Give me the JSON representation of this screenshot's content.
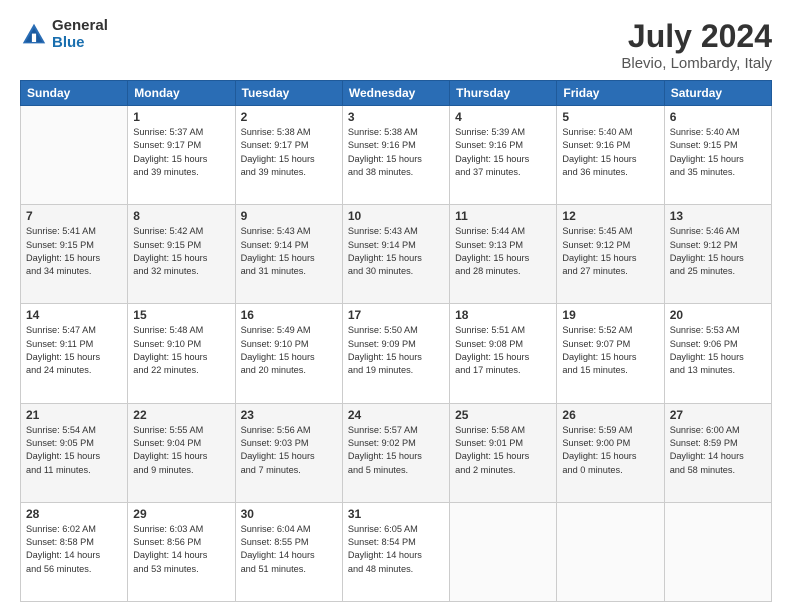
{
  "header": {
    "logo_general": "General",
    "logo_blue": "Blue",
    "title": "July 2024",
    "location": "Blevio, Lombardy, Italy"
  },
  "calendar": {
    "days_of_week": [
      "Sunday",
      "Monday",
      "Tuesday",
      "Wednesday",
      "Thursday",
      "Friday",
      "Saturday"
    ],
    "weeks": [
      [
        {
          "day": "",
          "info": ""
        },
        {
          "day": "1",
          "info": "Sunrise: 5:37 AM\nSunset: 9:17 PM\nDaylight: 15 hours\nand 39 minutes."
        },
        {
          "day": "2",
          "info": "Sunrise: 5:38 AM\nSunset: 9:17 PM\nDaylight: 15 hours\nand 39 minutes."
        },
        {
          "day": "3",
          "info": "Sunrise: 5:38 AM\nSunset: 9:16 PM\nDaylight: 15 hours\nand 38 minutes."
        },
        {
          "day": "4",
          "info": "Sunrise: 5:39 AM\nSunset: 9:16 PM\nDaylight: 15 hours\nand 37 minutes."
        },
        {
          "day": "5",
          "info": "Sunrise: 5:40 AM\nSunset: 9:16 PM\nDaylight: 15 hours\nand 36 minutes."
        },
        {
          "day": "6",
          "info": "Sunrise: 5:40 AM\nSunset: 9:15 PM\nDaylight: 15 hours\nand 35 minutes."
        }
      ],
      [
        {
          "day": "7",
          "info": "Sunrise: 5:41 AM\nSunset: 9:15 PM\nDaylight: 15 hours\nand 34 minutes."
        },
        {
          "day": "8",
          "info": "Sunrise: 5:42 AM\nSunset: 9:15 PM\nDaylight: 15 hours\nand 32 minutes."
        },
        {
          "day": "9",
          "info": "Sunrise: 5:43 AM\nSunset: 9:14 PM\nDaylight: 15 hours\nand 31 minutes."
        },
        {
          "day": "10",
          "info": "Sunrise: 5:43 AM\nSunset: 9:14 PM\nDaylight: 15 hours\nand 30 minutes."
        },
        {
          "day": "11",
          "info": "Sunrise: 5:44 AM\nSunset: 9:13 PM\nDaylight: 15 hours\nand 28 minutes."
        },
        {
          "day": "12",
          "info": "Sunrise: 5:45 AM\nSunset: 9:12 PM\nDaylight: 15 hours\nand 27 minutes."
        },
        {
          "day": "13",
          "info": "Sunrise: 5:46 AM\nSunset: 9:12 PM\nDaylight: 15 hours\nand 25 minutes."
        }
      ],
      [
        {
          "day": "14",
          "info": "Sunrise: 5:47 AM\nSunset: 9:11 PM\nDaylight: 15 hours\nand 24 minutes."
        },
        {
          "day": "15",
          "info": "Sunrise: 5:48 AM\nSunset: 9:10 PM\nDaylight: 15 hours\nand 22 minutes."
        },
        {
          "day": "16",
          "info": "Sunrise: 5:49 AM\nSunset: 9:10 PM\nDaylight: 15 hours\nand 20 minutes."
        },
        {
          "day": "17",
          "info": "Sunrise: 5:50 AM\nSunset: 9:09 PM\nDaylight: 15 hours\nand 19 minutes."
        },
        {
          "day": "18",
          "info": "Sunrise: 5:51 AM\nSunset: 9:08 PM\nDaylight: 15 hours\nand 17 minutes."
        },
        {
          "day": "19",
          "info": "Sunrise: 5:52 AM\nSunset: 9:07 PM\nDaylight: 15 hours\nand 15 minutes."
        },
        {
          "day": "20",
          "info": "Sunrise: 5:53 AM\nSunset: 9:06 PM\nDaylight: 15 hours\nand 13 minutes."
        }
      ],
      [
        {
          "day": "21",
          "info": "Sunrise: 5:54 AM\nSunset: 9:05 PM\nDaylight: 15 hours\nand 11 minutes."
        },
        {
          "day": "22",
          "info": "Sunrise: 5:55 AM\nSunset: 9:04 PM\nDaylight: 15 hours\nand 9 minutes."
        },
        {
          "day": "23",
          "info": "Sunrise: 5:56 AM\nSunset: 9:03 PM\nDaylight: 15 hours\nand 7 minutes."
        },
        {
          "day": "24",
          "info": "Sunrise: 5:57 AM\nSunset: 9:02 PM\nDaylight: 15 hours\nand 5 minutes."
        },
        {
          "day": "25",
          "info": "Sunrise: 5:58 AM\nSunset: 9:01 PM\nDaylight: 15 hours\nand 2 minutes."
        },
        {
          "day": "26",
          "info": "Sunrise: 5:59 AM\nSunset: 9:00 PM\nDaylight: 15 hours\nand 0 minutes."
        },
        {
          "day": "27",
          "info": "Sunrise: 6:00 AM\nSunset: 8:59 PM\nDaylight: 14 hours\nand 58 minutes."
        }
      ],
      [
        {
          "day": "28",
          "info": "Sunrise: 6:02 AM\nSunset: 8:58 PM\nDaylight: 14 hours\nand 56 minutes."
        },
        {
          "day": "29",
          "info": "Sunrise: 6:03 AM\nSunset: 8:56 PM\nDaylight: 14 hours\nand 53 minutes."
        },
        {
          "day": "30",
          "info": "Sunrise: 6:04 AM\nSunset: 8:55 PM\nDaylight: 14 hours\nand 51 minutes."
        },
        {
          "day": "31",
          "info": "Sunrise: 6:05 AM\nSunset: 8:54 PM\nDaylight: 14 hours\nand 48 minutes."
        },
        {
          "day": "",
          "info": ""
        },
        {
          "day": "",
          "info": ""
        },
        {
          "day": "",
          "info": ""
        }
      ]
    ]
  }
}
